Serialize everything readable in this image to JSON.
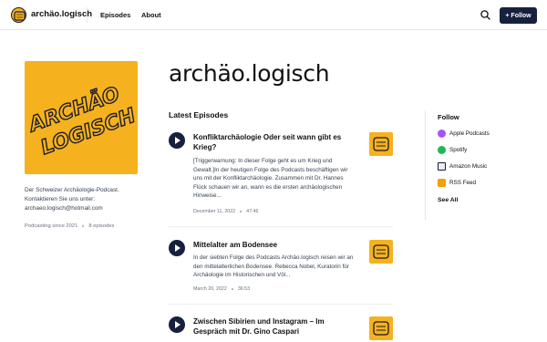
{
  "header": {
    "brand": "archäo.logisch",
    "nav": [
      "Episodes",
      "About"
    ],
    "follow_button": "+ Follow"
  },
  "podcast": {
    "title": "archäo.logisch",
    "cover_text": [
      "ARCHÄO",
      "LOGISCH"
    ],
    "description": "Der Schweizer Archäologie-Podcast. Kontaktieren Sie uns unter: archaeo.logisch@hotmail.com",
    "since": "Podcasting since 2021",
    "episode_count": "8 episodes"
  },
  "episodes_section": {
    "title": "Latest Episodes",
    "items": [
      {
        "title": "Konfliktarchäologie Oder seit wann gibt es Krieg?",
        "description": "[Triggerwarnung: In dieser Folge geht es um Krieg und Gewalt.]In der heutigen Folge des Podcasts beschäftigen wir uns mit der Konfliktarchäologie. Zusammen mit Dr. Hannes Flück schauen wir an, wann es die ersten archäologischen Hinweise...",
        "date": "December 11, 2022",
        "duration": "47:46"
      },
      {
        "title": "Mittelalter am Bodensee",
        "description": "In der siebten Folge des Podcasts Archäo.logisch reisen wir an den mittelalterlichen Bodensee. Rebecca Nobel, Kuratorin für Archäologie im Historischen und Völ...",
        "date": "March 20, 2022",
        "duration": "36:53"
      },
      {
        "title": "Zwischen Sibirien und Instagram – Im Gespräch mit Dr. Gino Caspari",
        "description": "",
        "date": "",
        "duration": ""
      }
    ]
  },
  "follow_panel": {
    "title": "Follow",
    "items": [
      {
        "label": "Apple Podcasts",
        "icon": "apple-podcasts-icon",
        "color": "#a855f7"
      },
      {
        "label": "Spotify",
        "icon": "spotify-icon",
        "color": "#1db954"
      },
      {
        "label": "Amazon Music",
        "icon": "amazon-music-icon",
        "color": "#1a1a2e"
      },
      {
        "label": "RSS Feed",
        "icon": "rss-icon",
        "color": "#f59e0b"
      }
    ],
    "see_all": "See All"
  },
  "colors": {
    "accent": "#16213e",
    "cover_yellow": "#f5b21e"
  }
}
